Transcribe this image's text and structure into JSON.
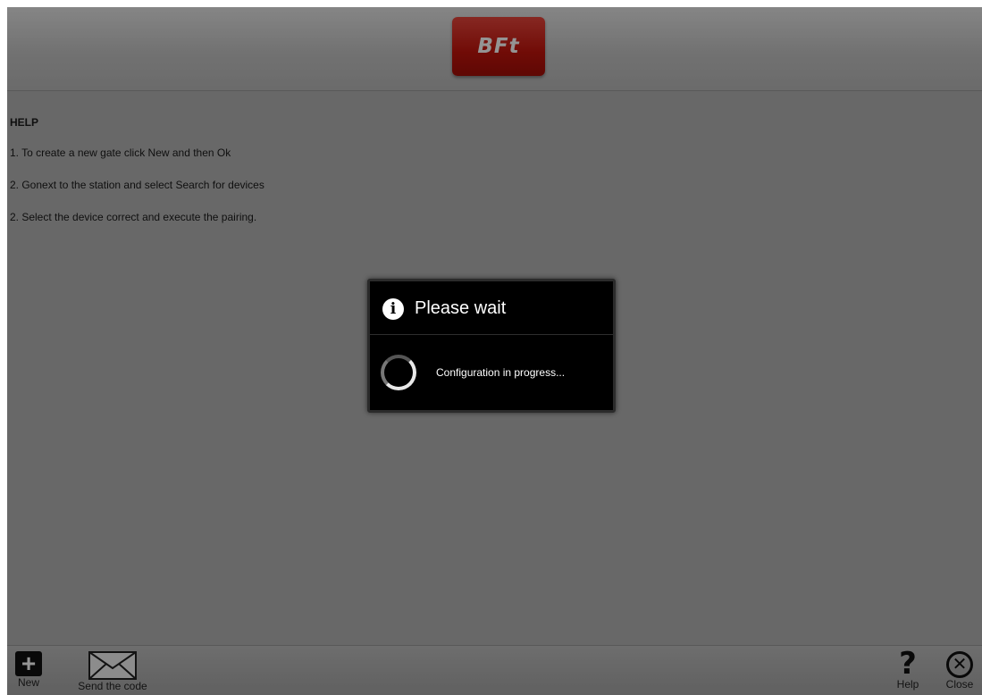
{
  "header": {
    "logo_text": "BFt",
    "brand_color": "#c2140c"
  },
  "help": {
    "title": "HELP",
    "lines": [
      "1. To create a new gate click New and then Ok",
      "2. Gonext to the station and select Search for devices",
      "2. Select the device correct and execute the pairing."
    ]
  },
  "dialog": {
    "title": "Please wait",
    "icon": "info-icon",
    "message": "Configuration in progress..."
  },
  "bottombar": {
    "new_label": "New",
    "send_label": "Send the code",
    "help_label": "Help",
    "close_label": "Close"
  }
}
